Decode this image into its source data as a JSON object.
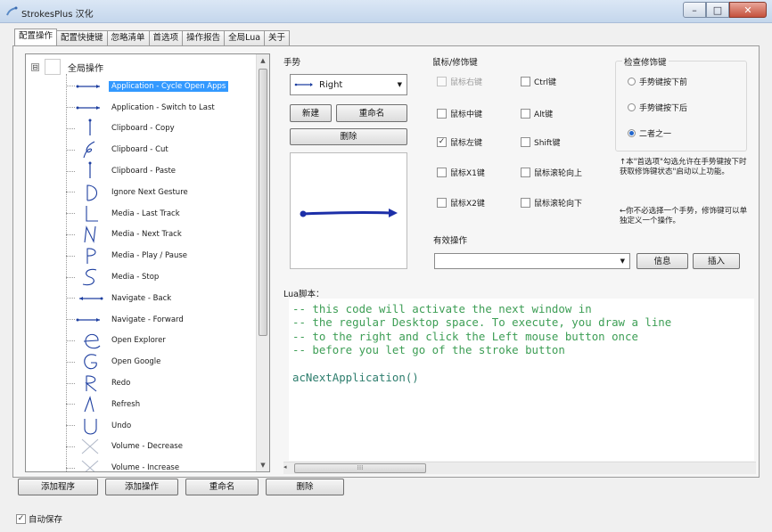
{
  "window": {
    "title": "StrokesPlus 汉化",
    "minimize": "–",
    "maximize": "□",
    "close": "✕"
  },
  "tabs": [
    {
      "label": "配置操作",
      "active": true
    },
    {
      "label": "配置快捷键",
      "active": false
    },
    {
      "label": "忽略清单",
      "active": false
    },
    {
      "label": "首选项",
      "active": false
    },
    {
      "label": "操作报告",
      "active": false
    },
    {
      "label": "全局Lua",
      "active": false
    },
    {
      "label": "关于",
      "active": false
    }
  ],
  "tree": {
    "expander": "⊟",
    "root_label": "全局操作",
    "items": [
      {
        "label": "Application - Cycle Open Apps",
        "icon": "arrow-right-gesture",
        "selected": true
      },
      {
        "label": "Application - Switch to Last",
        "icon": "arrow-right-gesture",
        "selected": false
      },
      {
        "label": "Clipboard - Copy",
        "icon": "arrow-down-gesture",
        "selected": false
      },
      {
        "label": "Clipboard - Cut",
        "icon": "loop-gesture",
        "selected": false
      },
      {
        "label": "Clipboard - Paste",
        "icon": "arrow-down-gesture",
        "selected": false
      },
      {
        "label": "Ignore Next Gesture",
        "icon": "d-gesture",
        "selected": false
      },
      {
        "label": "Media - Last Track",
        "icon": "l-gesture",
        "selected": false
      },
      {
        "label": "Media - Next Track",
        "icon": "n-gesture",
        "selected": false
      },
      {
        "label": "Media - Play / Pause",
        "icon": "p-gesture",
        "selected": false
      },
      {
        "label": "Media - Stop",
        "icon": "s-gesture",
        "selected": false
      },
      {
        "label": "Navigate - Back",
        "icon": "arrow-left-gesture",
        "selected": false
      },
      {
        "label": "Navigate - Forward",
        "icon": "arrow-right-gesture",
        "selected": false
      },
      {
        "label": "Open Explorer",
        "icon": "e-gesture",
        "selected": false
      },
      {
        "label": "Open Google",
        "icon": "g-gesture",
        "selected": false
      },
      {
        "label": "Redo",
        "icon": "r-gesture",
        "selected": false
      },
      {
        "label": "Refresh",
        "icon": "triangle-gesture",
        "selected": false
      },
      {
        "label": "Undo",
        "icon": "u-gesture",
        "selected": false
      },
      {
        "label": "Volume - Decrease",
        "icon": "x-gesture",
        "selected": false
      },
      {
        "label": "Volume - Increase",
        "icon": "x-gesture",
        "selected": false
      }
    ]
  },
  "bottom_buttons": {
    "add_program": "添加程序",
    "add_action": "添加操作",
    "rename": "重命名",
    "delete": "删除"
  },
  "autosave": {
    "label": "自动保存",
    "checked": true,
    "mark": "✓"
  },
  "gesture": {
    "group_label": "手势",
    "selected": "Right",
    "new_button": "新建",
    "rename_button": "重命名",
    "delete_button": "删除"
  },
  "modifiers": {
    "group_label": "鼠标/修饰键",
    "right_button": {
      "label": "鼠标右键",
      "checked": false,
      "disabled": true
    },
    "ctrl": {
      "label": "Ctrl键",
      "checked": false
    },
    "middle_button": {
      "label": "鼠标中键",
      "checked": false
    },
    "alt": {
      "label": "Alt键",
      "checked": false
    },
    "left_button": {
      "label": "鼠标左键",
      "checked": true
    },
    "shift": {
      "label": "Shift键",
      "checked": false
    },
    "x1_button": {
      "label": "鼠标X1键",
      "checked": false
    },
    "wheel_up": {
      "label": "鼠标滚轮向上",
      "checked": false
    },
    "x2_button": {
      "label": "鼠标X2键",
      "checked": false
    },
    "wheel_down": {
      "label": "鼠标滚轮向下",
      "checked": false
    }
  },
  "check_modifier": {
    "group_label": "检查修饰键",
    "before": {
      "label": "手势键按下前",
      "selected": false
    },
    "after": {
      "label": "手势键按下后",
      "selected": false
    },
    "either": {
      "label": "二者之一",
      "selected": true
    },
    "note1": "↑本\"首选项\"勾选允许在手势键按下时获取修饰键状态\"启动以上功能。",
    "note2": "←你不必选择一个手势，修饰键可以单独定义一个操作。"
  },
  "valid_action": {
    "label": "有效操作",
    "value": "",
    "info_button": "信息",
    "insert_button": "插入"
  },
  "lua": {
    "label": "Lua脚本：",
    "comment_lines": [
      "-- this code will activate the next window in",
      "-- the regular Desktop space. To execute, you draw a line",
      "-- to the right and click the Left mouse button once",
      "-- before you let go of the stroke button"
    ],
    "code_line": "acNextApplication()",
    "grip": "⁞⁞⁞"
  }
}
